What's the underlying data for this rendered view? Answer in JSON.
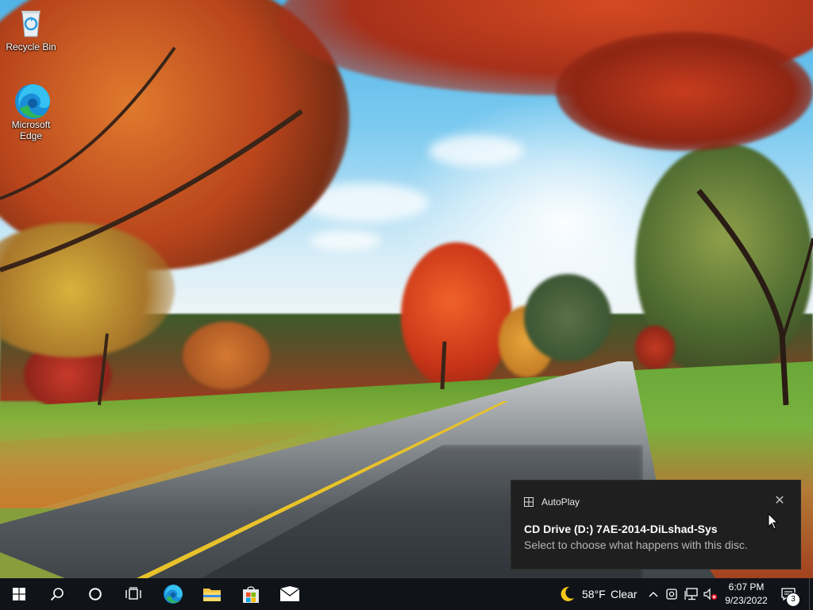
{
  "desktop": {
    "icons": [
      {
        "label": "Recycle Bin",
        "icon": "recycle-bin-icon"
      },
      {
        "label": "Microsoft Edge",
        "icon": "edge-icon"
      }
    ]
  },
  "toast": {
    "app_name": "AutoPlay",
    "title": "CD Drive (D:) 7AE-2014-DiLshad-Sys",
    "body": "Select to choose what happens with this disc.",
    "close_glyph": "✕",
    "background": "#1f1f1f"
  },
  "taskbar": {
    "background": "#101418",
    "pinned": [
      "start-icon",
      "search-icon",
      "cortana-icon",
      "task-view-icon",
      "edge-icon",
      "file-explorer-icon",
      "store-icon",
      "mail-icon"
    ],
    "weather": {
      "temp": "58°F",
      "condition": "Clear",
      "icon": "moon-icon"
    },
    "tray_icons": [
      "chevron-up-icon",
      "meet-now-icon",
      "network-icon",
      "volume-muted-icon"
    ],
    "time": "6:07 PM",
    "date": "9/23/2022",
    "notification_count": "3"
  }
}
